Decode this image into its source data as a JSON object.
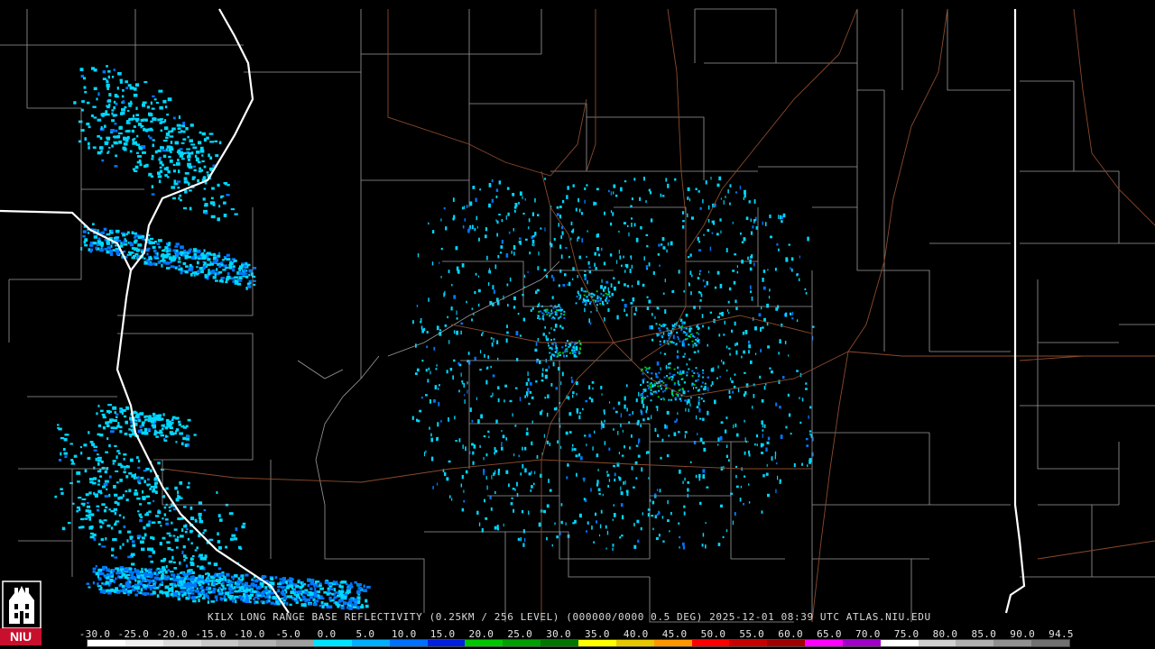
{
  "caption": "KILX LONG RANGE BASE REFLECTIVITY (0.25KM / 256 LEVEL) (000000/0000 0.5 DEG) 2025-12-01 08:39 UTC  ATLAS.NIU.EDU",
  "colorbar": {
    "tick_labels": [
      "-30.0",
      "-25.0",
      "-20.0",
      "-15.0",
      "-10.0",
      "-5.0",
      "0.0",
      "5.0",
      "10.0",
      "15.0",
      "20.0",
      "25.0",
      "30.0",
      "35.0",
      "40.0",
      "45.0",
      "50.0",
      "55.0",
      "60.0",
      "65.0",
      "70.0",
      "75.0",
      "80.0",
      "85.0",
      "90.0",
      "94.5"
    ],
    "colors": [
      "#ffffff",
      "#f0f0f0",
      "#dcdcdc",
      "#c8c8c8",
      "#b4b4b4",
      "#a0a0a0",
      "#00e5ff",
      "#00b0ff",
      "#0070ff",
      "#0020e0",
      "#00c800",
      "#00a000",
      "#007800",
      "#ffff00",
      "#e6c800",
      "#ff9600",
      "#ff0000",
      "#c80000",
      "#a00000",
      "#ff00ff",
      "#a000c8",
      "#ffffff",
      "#d0d0d0",
      "#b0b0b0",
      "#909090",
      "#707070"
    ]
  },
  "logo": {
    "text": "NIU"
  },
  "map_colors": {
    "county_lines": "#9a9a9a",
    "state_lines": "#ffffff",
    "roads": "#8b4a2b",
    "echo_light": "#00d8ff",
    "echo_mid": "#0078ff",
    "echo_strong": "#00c800"
  }
}
